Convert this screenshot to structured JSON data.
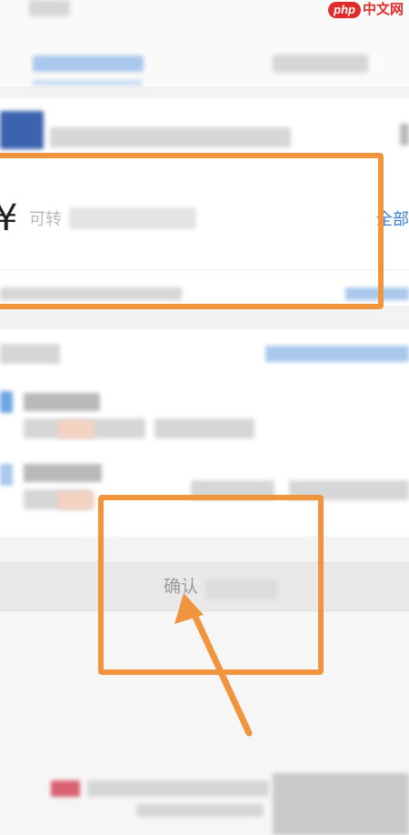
{
  "watermark": {
    "logo": "php",
    "text": "中文网"
  },
  "amount": {
    "currency_symbol": "¥",
    "placeholder_text": "可转",
    "all_link": "全部"
  },
  "confirm_button": {
    "label": "确认"
  },
  "colors": {
    "highlight": "#f0953e",
    "link": "#3a7fd6",
    "watermark": "#e02b2b"
  },
  "icons": {
    "yen": "yen-icon",
    "arrow": "arrow-annotation"
  }
}
